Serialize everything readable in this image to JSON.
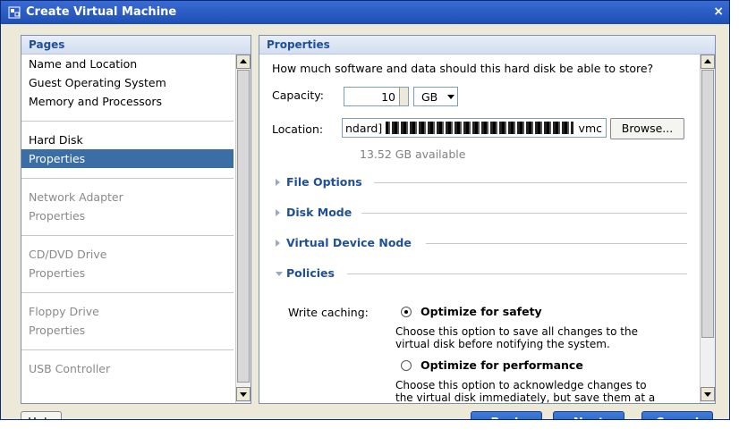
{
  "window": {
    "title": "Create Virtual Machine",
    "close_glyph": "×"
  },
  "pages": {
    "header": "Pages",
    "groups": [
      [
        "Name and Location",
        "Guest Operating System",
        "Memory and Processors"
      ],
      [
        "Hard Disk",
        "Properties"
      ],
      [
        "Network Adapter",
        "Properties"
      ],
      [
        "CD/DVD Drive",
        "Properties"
      ],
      [
        "Floppy Drive",
        "Properties"
      ],
      [
        "USB Controller"
      ]
    ]
  },
  "properties": {
    "header": "Properties",
    "question": "How much software and data should this hard disk be able to store?",
    "capacity_label": "Capacity:",
    "capacity_value": "10",
    "capacity_unit": "GB",
    "location_label": "Location:",
    "location_prefix": "ndard]",
    "location_suffix": "vmc",
    "browse_label": "Browse...",
    "available_text": "13.52 GB available",
    "sections": {
      "file_options": "File Options",
      "disk_mode": "Disk Mode",
      "virtual_device_node": "Virtual Device Node",
      "policies": "Policies"
    },
    "write_caching_label": "Write caching:",
    "opt_safety_label": "Optimize for safety",
    "opt_safety_desc_1": "Choose this option to save all changes to the",
    "opt_safety_desc_2": "virtual disk before notifying the system.",
    "opt_performance_label": "Optimize for performance",
    "opt_performance_desc_1": "Choose this option to acknowledge changes to",
    "opt_performance_desc_2": "the virtual disk immediately, but save them at a"
  },
  "footer": {
    "help_label": "Help",
    "back_label": "Back",
    "next_label": "Next",
    "cancel_label": "Cancel"
  }
}
